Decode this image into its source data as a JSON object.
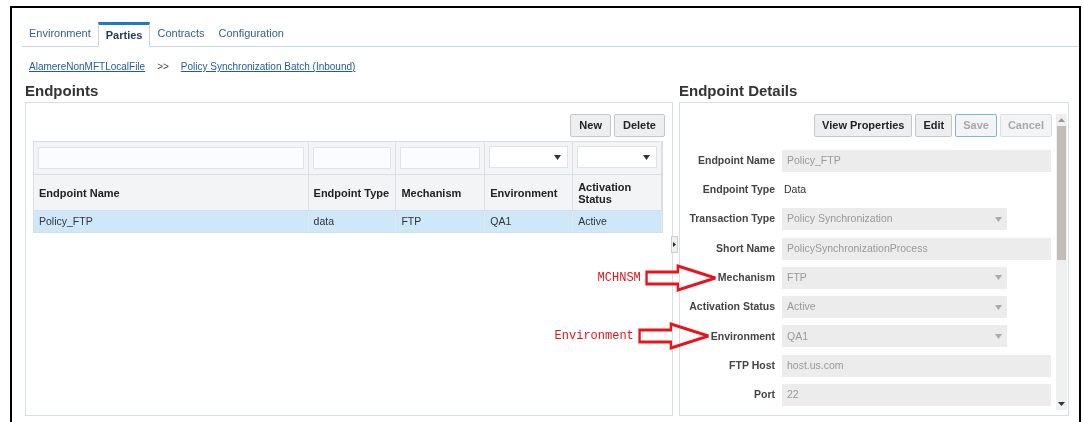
{
  "tabs": [
    {
      "label": "Environment",
      "selected": false
    },
    {
      "label": "Parties",
      "selected": true
    },
    {
      "label": "Contracts",
      "selected": false
    },
    {
      "label": "Configuration",
      "selected": false
    }
  ],
  "breadcrumb": {
    "items": [
      "AlamereNonMFTLocalFile",
      "Policy Synchronization Batch (Inbound)"
    ],
    "separator": ">>"
  },
  "endpoints": {
    "title": "Endpoints",
    "buttons": [
      {
        "label": "New",
        "disabled": false
      },
      {
        "label": "Delete",
        "disabled": false
      }
    ],
    "filters": [
      {
        "kind": "text"
      },
      {
        "kind": "text"
      },
      {
        "kind": "text"
      },
      {
        "kind": "select"
      },
      {
        "kind": "select"
      }
    ],
    "columns": [
      "Endpoint Name",
      "Endpoint Type",
      "Mechanism",
      "Environment",
      "Activation Status"
    ],
    "rows": [
      {
        "cells": [
          "Policy_FTP",
          "data",
          "FTP",
          "QA1",
          "Active"
        ],
        "selected": true
      }
    ]
  },
  "details": {
    "title": "Endpoint Details",
    "buttons": [
      {
        "label": "View Properties",
        "disabled": false,
        "focused": false
      },
      {
        "label": "Edit",
        "disabled": false,
        "focused": false
      },
      {
        "label": "Save",
        "disabled": true,
        "focused": true
      },
      {
        "label": "Cancel",
        "disabled": true,
        "focused": false
      }
    ],
    "fields": [
      {
        "label": "Endpoint Name",
        "kind": "text",
        "value": "Policy_FTP",
        "disabled": true
      },
      {
        "label": "Endpoint Type",
        "kind": "static",
        "value": "Data",
        "disabled": false
      },
      {
        "label": "Transaction Type",
        "kind": "select",
        "value": "Policy Synchronization",
        "disabled": true
      },
      {
        "label": "Short Name",
        "kind": "text",
        "value": "PolicySynchronizationProcess",
        "disabled": true
      },
      {
        "label": "Mechanism",
        "kind": "select",
        "value": "FTP",
        "disabled": true,
        "annotation": "MCHNSM"
      },
      {
        "label": "Activation Status",
        "kind": "select",
        "value": "Active",
        "disabled": true
      },
      {
        "label": "Environment",
        "kind": "select",
        "value": "QA1",
        "disabled": true,
        "annotation": "Environment"
      },
      {
        "label": "FTP Host",
        "kind": "text",
        "value": "host.us.com",
        "disabled": true
      },
      {
        "label": "Port",
        "kind": "text",
        "value": "22",
        "disabled": true
      }
    ]
  }
}
